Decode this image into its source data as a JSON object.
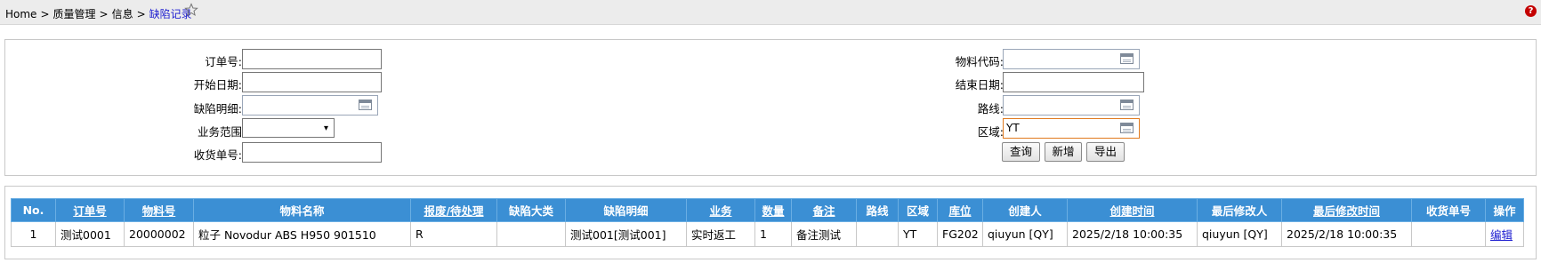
{
  "breadcrumb": {
    "items": [
      "Home",
      "质量管理",
      "信息",
      "缺陷记录"
    ],
    "separator": ">"
  },
  "search": {
    "order_no": {
      "label": "订单号:",
      "value": ""
    },
    "start_date": {
      "label": "开始日期:",
      "value": ""
    },
    "defect_detail": {
      "label": "缺陷明细:",
      "value": ""
    },
    "business_scope": {
      "label": "业务范围",
      "value": ""
    },
    "receipt_no": {
      "label": "收货单号:",
      "value": ""
    },
    "material_code": {
      "label": "物料代码:",
      "value": ""
    },
    "end_date": {
      "label": "结束日期:",
      "value": ""
    },
    "route": {
      "label": "路线:",
      "value": ""
    },
    "area": {
      "label": "区域:",
      "value": "YT"
    },
    "buttons": {
      "query": "查询",
      "add": "新增",
      "export": "导出"
    }
  },
  "table": {
    "columns": [
      "No.",
      "订单号",
      "物料号",
      "物料名称",
      "报废/待处理",
      "缺陷大类",
      "缺陷明细",
      "业务",
      "数量",
      "备注",
      "路线",
      "区域",
      "库位",
      "创建人",
      "创建时间",
      "最后修改人",
      "最后修改时间",
      "收货单号",
      "操作"
    ],
    "rows": [
      [
        "1",
        "测试0001",
        "20000002",
        "粒子 Novodur ABS H950 901510",
        "R",
        "",
        "测试001[测试001]",
        "实时返工",
        "1",
        "备注测试",
        "",
        "YT",
        "FG202",
        "qiuyun [QY]",
        "2025/2/18 10:00:35",
        "qiuyun [QY]",
        "2025/2/18 10:00:35",
        "",
        "编辑"
      ]
    ]
  },
  "colors": {
    "header_bg": "#3b8fd4",
    "link": "#1d1dd0",
    "focus_border": "#e07a1f"
  },
  "icons": [
    "star-icon",
    "help-icon",
    "calendar-icon",
    "chevron-down-icon"
  ]
}
